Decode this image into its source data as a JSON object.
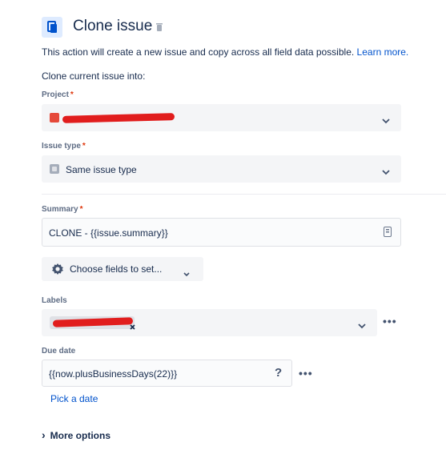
{
  "header": {
    "title": "Clone issue",
    "icon": "clone-icon"
  },
  "description": {
    "text": "This action will create a new issue and copy across all field data possible.",
    "link": "Learn more."
  },
  "clone_into": "Clone current issue into:",
  "project": {
    "label": "Project",
    "required": "*"
  },
  "issue_type": {
    "label": "Issue type",
    "required": "*",
    "value": "Same issue type"
  },
  "summary": {
    "label": "Summary",
    "required": "*",
    "value": "CLONE - {{issue.summary}}"
  },
  "choose_fields": {
    "label": "Choose fields to set..."
  },
  "labels": {
    "label": "Labels",
    "more_actions": "•••"
  },
  "due_date": {
    "label": "Due date",
    "value": "{{now.plusBusinessDays(22)}}",
    "help": "?",
    "more_actions": "•••",
    "pick_date": "Pick a date"
  },
  "more_options": {
    "label": "More options",
    "chevron": "›"
  },
  "colors": {
    "accent": "#0052cc",
    "required": "#de350b",
    "redaction": "#e11d1d"
  }
}
